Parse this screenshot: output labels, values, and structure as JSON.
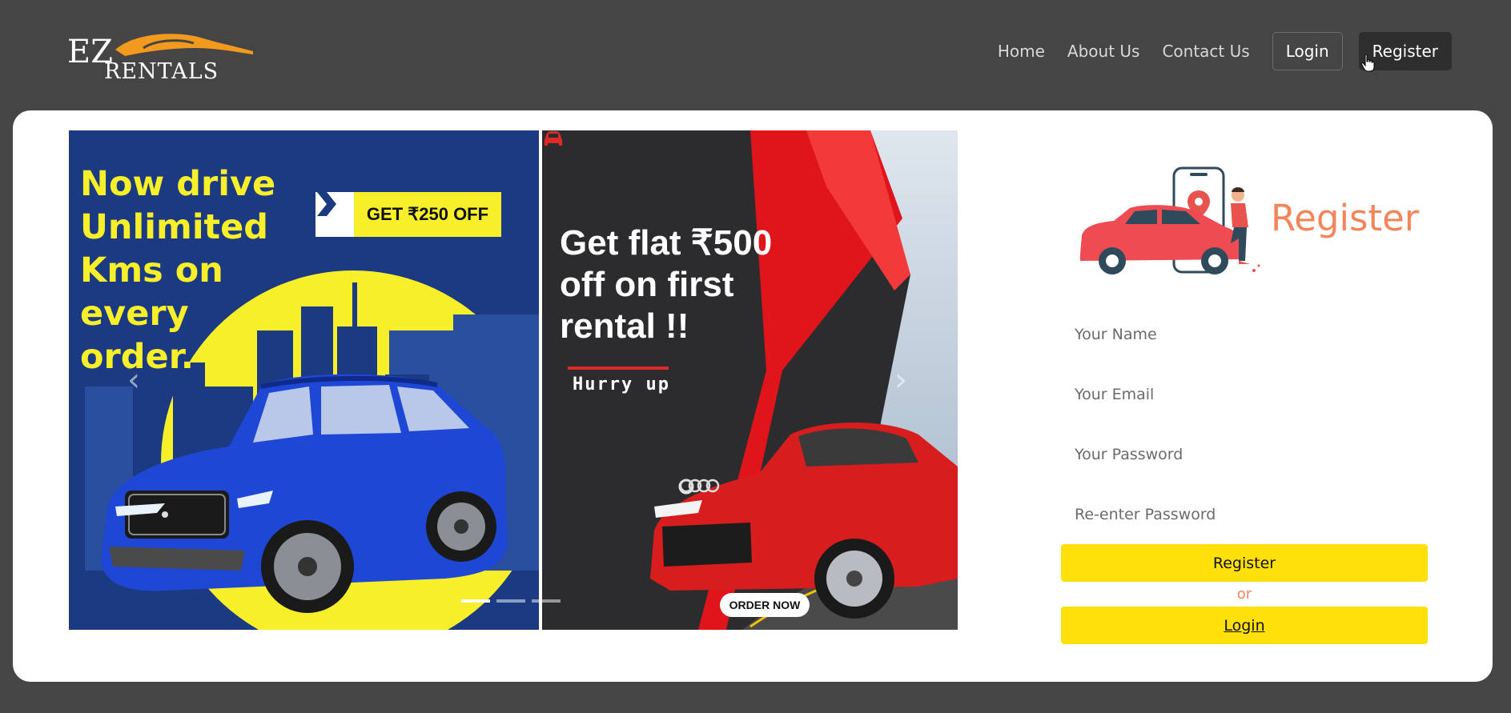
{
  "brand": {
    "logo_letters": "EZ",
    "logo_word": "RENTALS"
  },
  "nav": {
    "home": "Home",
    "about": "About Us",
    "contact": "Contact Us",
    "login": "Login",
    "register": "Register"
  },
  "carousel": {
    "slide_a": {
      "headline_lines": [
        "Now drive",
        "Unlimited",
        "Kms on",
        "every",
        "order."
      ],
      "offer": "GET ₹250 OFF"
    },
    "slide_b": {
      "headline_lines": [
        "Get flat ₹500",
        "off on first",
        "rental !!"
      ],
      "tagline": "Hurry up",
      "cta": "ORDER NOW"
    },
    "indicators": 3,
    "active_index": 0
  },
  "register_form": {
    "heading": "Register",
    "name_placeholder": "Your Name",
    "email_placeholder": "Your Email",
    "password_placeholder": "Your Password",
    "confirm_placeholder": "Re-enter Password",
    "register_button": "Register",
    "or_text": "or",
    "login_button": "Login"
  },
  "colors": {
    "page_bg": "#454545",
    "accent_orange": "#f4845a",
    "button_yellow": "#ffe00a",
    "promo_yellow": "#f7ef2a",
    "promo_blue": "#1b3a82",
    "promo_red": "#e02a2a"
  }
}
